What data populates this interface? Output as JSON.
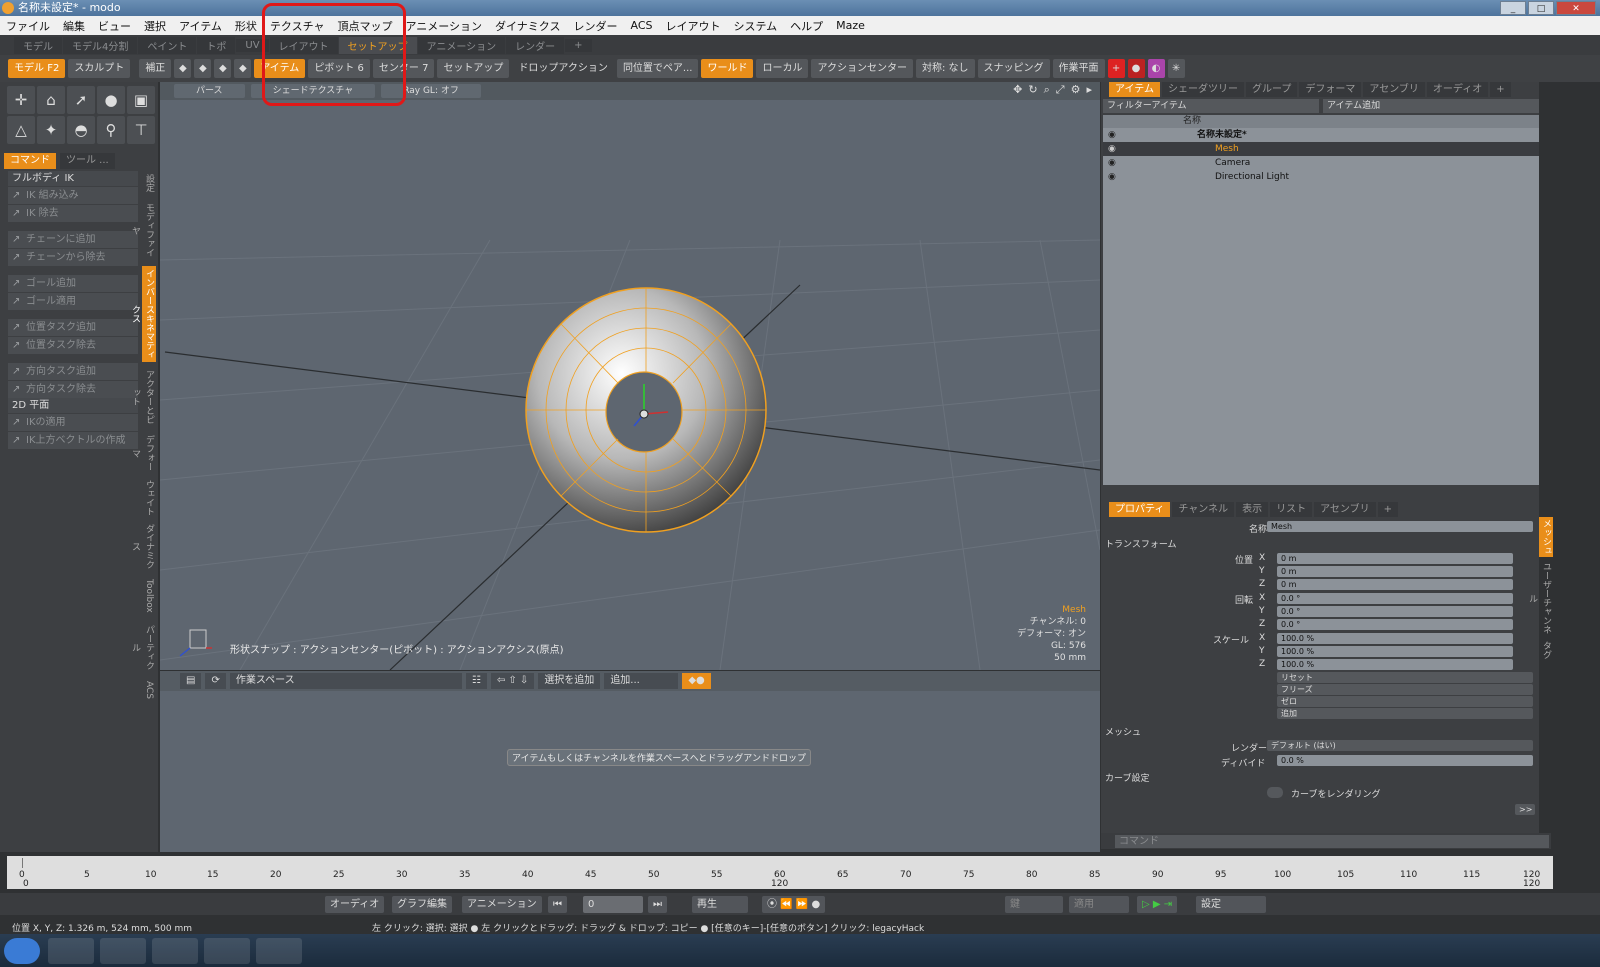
{
  "window": {
    "title": "名称未設定* - modo",
    "buttons": [
      "_",
      "□",
      "✕"
    ]
  },
  "menu": [
    "ファイル",
    "編集",
    "ビュー",
    "選択",
    "アイテム",
    "形状",
    "テクスチャ",
    "頂点マップ",
    "アニメーション",
    "ダイナミクス",
    "レンダー",
    "ACS",
    "レイアウト",
    "システム",
    "ヘルプ",
    "Maze"
  ],
  "layout_tabs": [
    "モデル",
    "モデル4分割",
    "ペイント",
    "トポ",
    "UV",
    "レイアウト",
    "セットアップ",
    "アニメーション",
    "レンダー",
    "+"
  ],
  "active_layout_tab": "セットアップ",
  "toolbar": {
    "model": "モデル",
    "model_key": "F2",
    "sculpt": "スカルプト",
    "correct": "補正",
    "item": "アイテム",
    "pivot": "ピボット",
    "pivot_key": "6",
    "center": "センター",
    "center_key": "7",
    "setup": "セットアップ",
    "drop_action": "ドロップアクション",
    "drop_value": "同位置でペア...",
    "world": "ワールド",
    "local": "ローカル",
    "action_center": "アクションセンター",
    "symmetry": "対称: なし",
    "snapping": "スナッピング",
    "work_plane": "作業平面"
  },
  "left": {
    "tabs": [
      "コマンド",
      "ツール ..."
    ],
    "groups": [
      {
        "header": "フルボディ IK",
        "cmds": [
          "IK 組み込み",
          "IK 除去"
        ]
      },
      {
        "header": "",
        "cmds": [
          "チェーンに追加",
          "チェーンから除去"
        ]
      },
      {
        "header": "",
        "cmds": [
          "ゴール追加",
          "ゴール適用"
        ]
      },
      {
        "header": "",
        "cmds": [
          "位置タスク追加",
          "位置タスク除去"
        ]
      },
      {
        "header": "",
        "cmds": [
          "方向タスク追加",
          "方向タスク除去"
        ]
      },
      {
        "header": "2D 平面",
        "cmds": [
          "IKの適用",
          "IK上方ベクトルの作成"
        ]
      }
    ],
    "vtabs": [
      "設定",
      "モディファイヤ",
      "インバースキネマティクス",
      "アクターとピット",
      "デフォーマ",
      "ウェイト",
      "ダイナミクス",
      "Toolbox",
      "パーティクル",
      "ACS"
    ],
    "active_vtab": "インバースキネマティクス"
  },
  "viewport": {
    "buttons": [
      "パース",
      "シェードテクスチャ",
      "Ray GL: オフ"
    ],
    "snap_text": "形状スナップ : アクションセンター(ピボット) : アクションアクシス(原点)",
    "info": {
      "mesh": "Mesh",
      "channel": "チャンネル: 0",
      "deformer": "デフォーマ: オン",
      "gl": "GL: 576",
      "size": "50 mm"
    }
  },
  "workspace": {
    "name": "作業スペース",
    "add_selection": "選択を追加",
    "add": "追加...",
    "hint": "アイテムもしくはチャンネルを作業スペースへとドラッグアンドドロップ"
  },
  "items": {
    "tabs": [
      "アイテム",
      "シェーダツリー",
      "グループ",
      "デフォーマ",
      "アセンブリ",
      "オーディオ",
      "+"
    ],
    "filter": "フィルターアイテム",
    "add_item": "アイテム追加",
    "col_name": "名称",
    "scene": "名称未設定*",
    "list": [
      "Mesh",
      "Camera",
      "Directional Light"
    ]
  },
  "props": {
    "tabs": [
      "プロパティ",
      "チャンネル",
      "表示",
      "リスト",
      "アセンブリ",
      "+"
    ],
    "name_label": "名称",
    "name_value": "Mesh",
    "transform": "トランスフォーム",
    "position_label": "位置",
    "rotation_label": "回転",
    "scale_label": "スケール",
    "axes": [
      "X",
      "Y",
      "Z"
    ],
    "position": [
      "0 m",
      "0 m",
      "0 m"
    ],
    "rotation": [
      "0.0 °",
      "0.0 °",
      "0.0 °"
    ],
    "scale": [
      "100.0 %",
      "100.0 %",
      "100.0 %"
    ],
    "actions": [
      "リセット",
      "フリーズ",
      "ゼロ",
      "追加"
    ],
    "mesh_section": "メッシュ",
    "render_label": "レンダー",
    "render_value": "デフォルト (はい)",
    "subdiv_label": "ディバイド",
    "subdiv_value": "0.0 %",
    "curve_section": "カーブ設定",
    "curve_render": "カーブをレンダリング",
    "more": ">>",
    "vtabs": [
      "メッシュ",
      "ユーザーチャンネル",
      "タグ"
    ]
  },
  "command_placeholder": "コマンド",
  "timeline": {
    "ticks": [
      "0",
      "5",
      "10",
      "15",
      "20",
      "25",
      "30",
      "35",
      "40",
      "45",
      "50",
      "55",
      "60",
      "65",
      "70",
      "75",
      "80",
      "85",
      "90",
      "95",
      "100",
      "105",
      "110",
      "115",
      "120"
    ],
    "start": "0",
    "mid": "120",
    "end": "120"
  },
  "bottom": {
    "audio": "オーディオ",
    "graph": "グラフ編集",
    "animation": "アニメーション",
    "frame": "0",
    "play": "再生",
    "key": "鍵",
    "apply": "適用",
    "settings": "設定"
  },
  "status": {
    "position": "位置 X, Y, Z:  1.326 m, 524 mm, 500 mm",
    "hint": "左 クリック: 選択: 選択 ● 左 クリックとドラッグ: ドラッグ & ドロップ: コピー ● [任意のキー]-[任意のボタン] クリック: legacyHack"
  }
}
